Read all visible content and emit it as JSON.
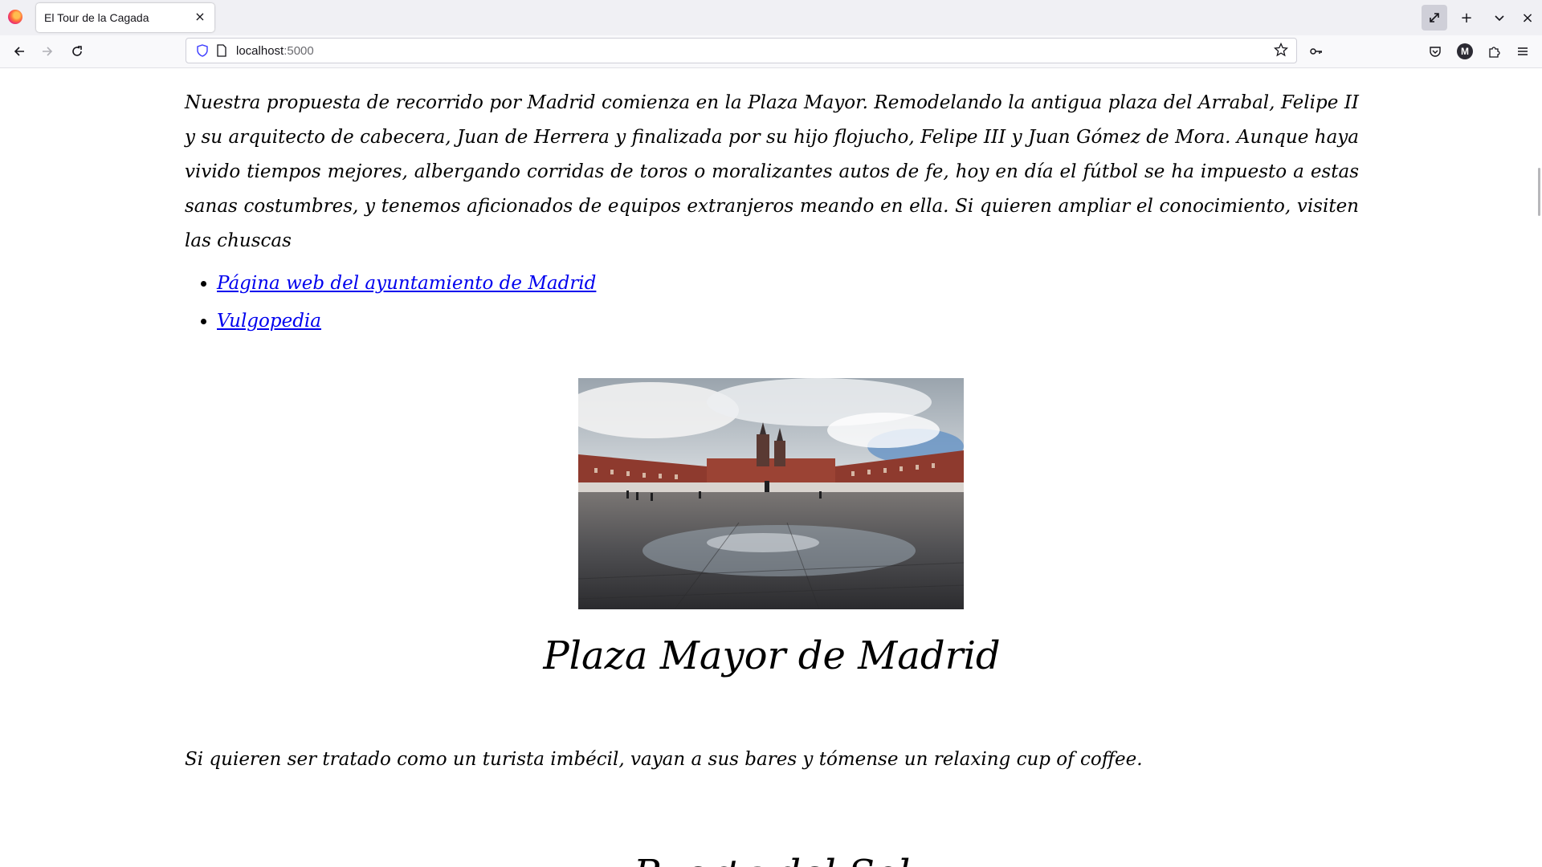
{
  "browser": {
    "tab_title": "El Tour de la Cagada",
    "tab_close_glyph": "×",
    "url_host": "localhost",
    "url_port": ":5000",
    "new_tab_glyph": "+",
    "window_close_glyph": "×"
  },
  "icons": {
    "firefox": "firefox-logo-icon",
    "expand": "expand-icon",
    "new_tab": "plus-icon",
    "tab_list": "chevron-down-icon",
    "close_window": "close-icon",
    "back": "back-arrow-icon",
    "forward": "forward-arrow-icon",
    "reload": "reload-icon",
    "shield": "shield-icon",
    "page": "page-icon",
    "bookmark": "star-icon",
    "passwords": "key-icon",
    "pocket": "pocket-icon",
    "account": "account-avatar-icon",
    "extensions": "puzzle-icon",
    "menu": "hamburger-menu-icon"
  },
  "account_initial": "M",
  "page": {
    "intro": "Nuestra propuesta de recorrido por Madrid comienza en la Plaza Mayor. Remodelando la antigua plaza del Arrabal, Felipe II y su arquitecto de cabecera, Juan de Herrera y finalizada por su hijo flojucho, Felipe III y Juan Gómez de Mora. Aunque haya vivido tiempos mejores, albergando corridas de toros o moralizantes autos de fe, hoy en día el fútbol se ha impuesto a estas sanas costumbres, y tenemos aficionados de equipos extranjeros meando en ella. Si quieren ampliar el conocimiento, visiten las chuscas",
    "links": [
      {
        "label": "Página web del ayuntamiento de Madrid"
      },
      {
        "label": "Vulgopedia"
      }
    ],
    "plaza_title": "Plaza Mayor de Madrid",
    "tip": "Si quieren ser tratado como un turista imbécil, vayan a sus bares y tómense un relaxing cup of coffee.",
    "next_title": "Puerta del Sol"
  }
}
